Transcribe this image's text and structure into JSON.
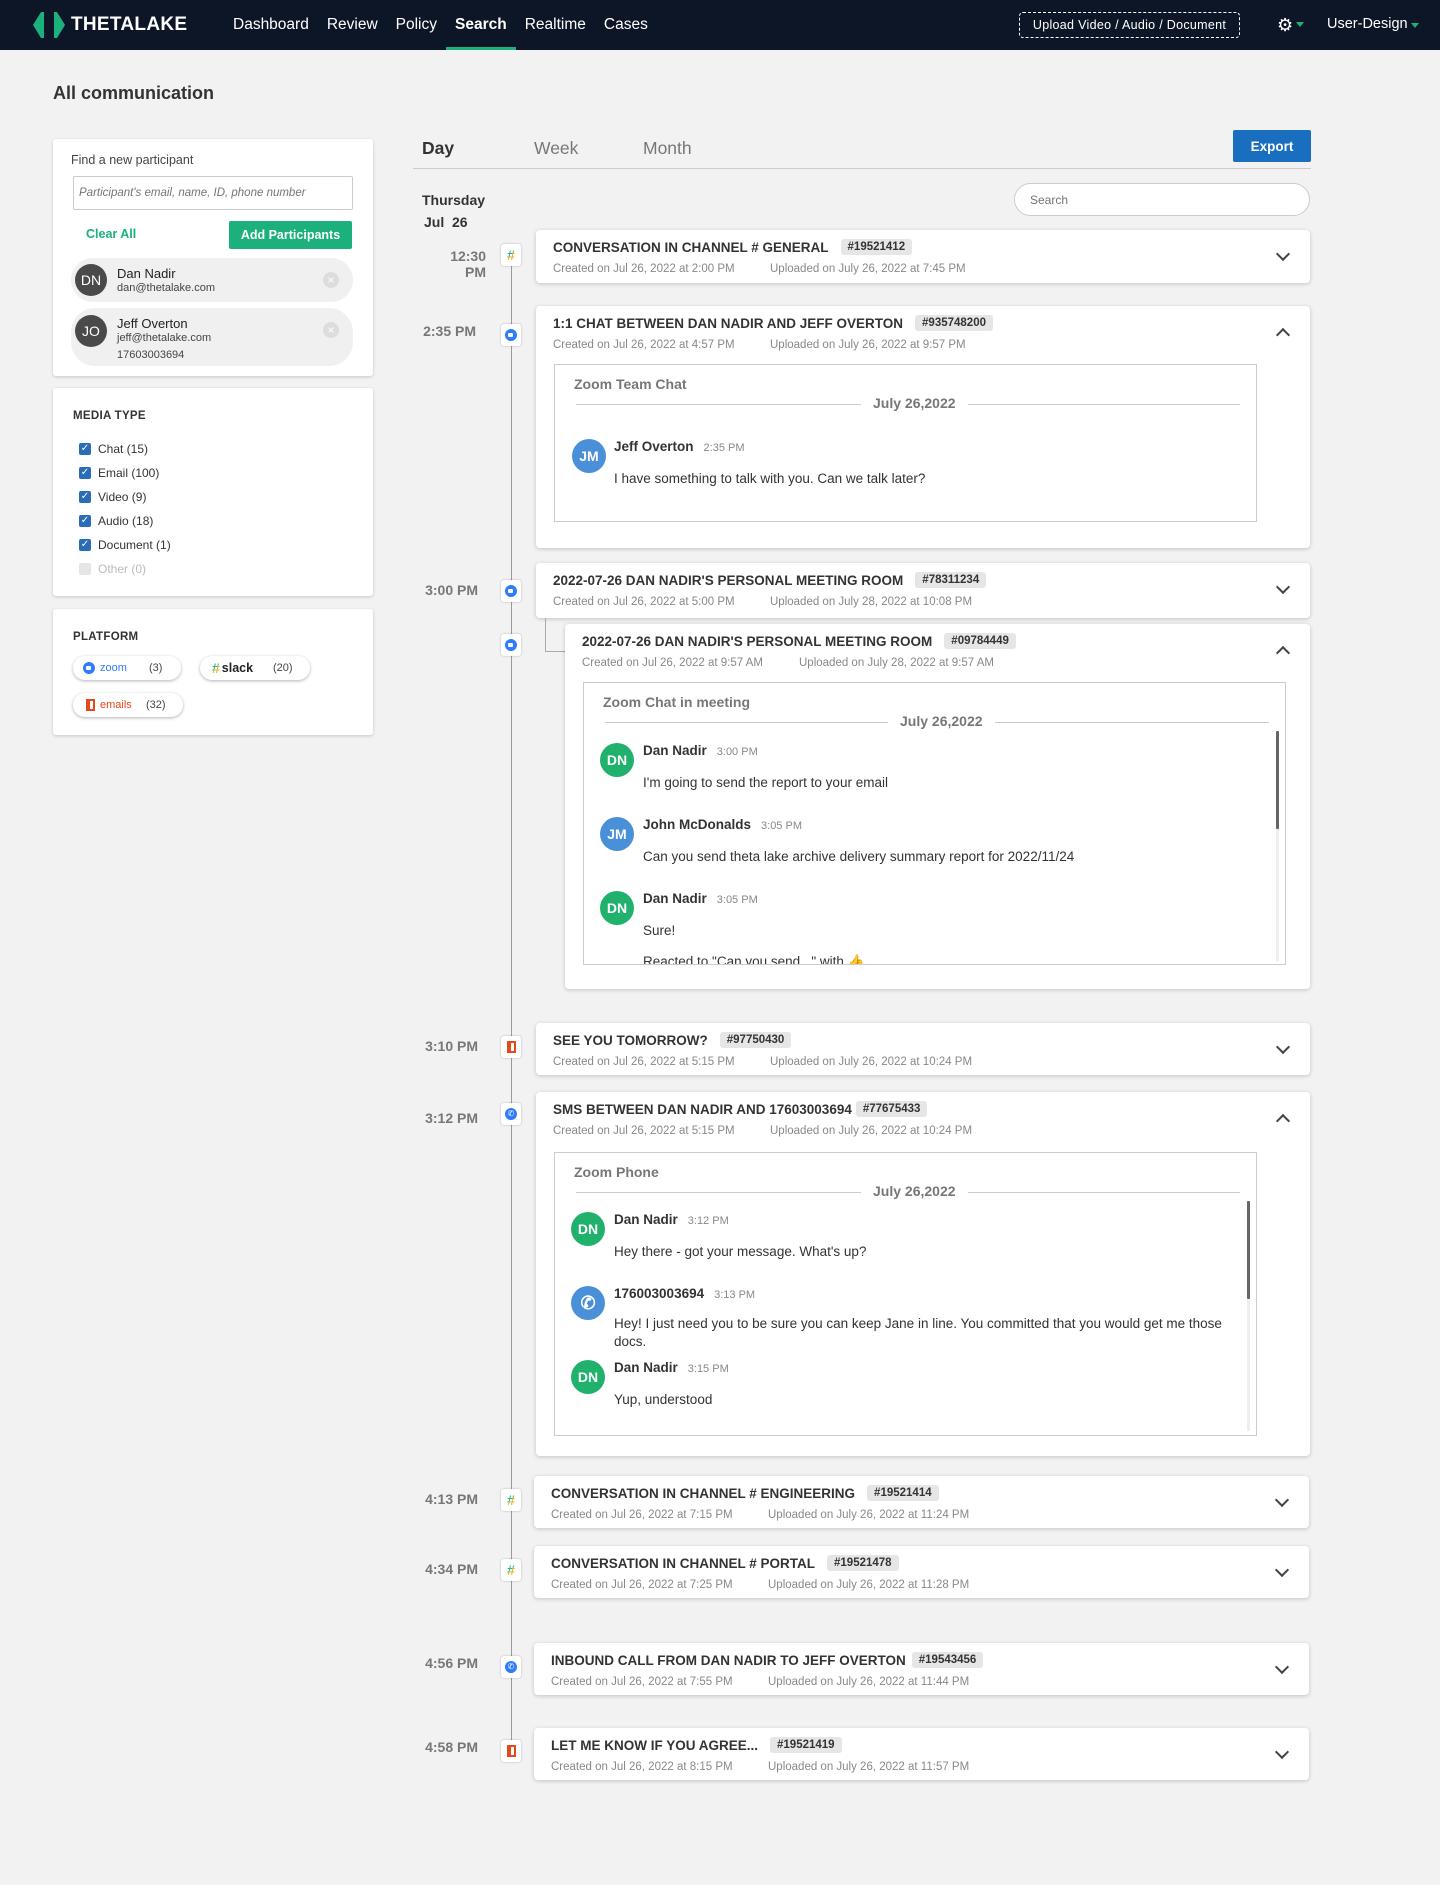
{
  "app": {
    "logo_text": "THETALAKE"
  },
  "nav": {
    "items": [
      {
        "label": "Dashboard",
        "active": false
      },
      {
        "label": "Review",
        "active": false
      },
      {
        "label": "Policy",
        "active": false
      },
      {
        "label": "Search",
        "active": true
      },
      {
        "label": "Realtime",
        "active": false
      },
      {
        "label": "Cases",
        "active": false
      }
    ],
    "upload_label": "Upload Video / Audio / Document",
    "settings_icon": "gear-icon",
    "user_label": "User-Design"
  },
  "colors": {
    "brand_green": "#1bb07c",
    "nav_bg": "#0d1626",
    "export_blue": "#1a6ec0",
    "checkbox_blue": "#2a6cb8",
    "avatar_green": "#20b16d",
    "avatar_blue": "#4a90d9"
  },
  "page": {
    "title": "All communication"
  },
  "participants": {
    "label": "Find a new participant",
    "placeholder": "Participant's email, name, ID, phone number",
    "clear_all": "Clear All",
    "add_button": "Add Participants",
    "list": [
      {
        "initials": "DN",
        "name": "Dan Nadir",
        "email": "dan@thetalake.com",
        "phone": ""
      },
      {
        "initials": "JO",
        "name": "Jeff Overton",
        "email": "jeff@thetalake.com",
        "phone": "17603003694"
      }
    ]
  },
  "media_type": {
    "title": "MEDIA TYPE",
    "items": [
      {
        "label": "Chat (15)",
        "checked": true
      },
      {
        "label": "Email (100)",
        "checked": true
      },
      {
        "label": "Video (9)",
        "checked": true
      },
      {
        "label": "Audio (18)",
        "checked": true
      },
      {
        "label": "Document (1)",
        "checked": true
      },
      {
        "label": "Other (0)",
        "checked": false
      }
    ]
  },
  "platform": {
    "title": "PLATFORM",
    "items": [
      {
        "name": "zoom",
        "count": "(3)",
        "icon": "zoom-icon"
      },
      {
        "name": "slack",
        "count": "(20)",
        "icon": "slack-icon"
      },
      {
        "name": "emails",
        "count": "(32)",
        "icon": "office-icon"
      }
    ]
  },
  "tabs": [
    {
      "label": "Day",
      "active": true
    },
    {
      "label": "Week",
      "active": false
    },
    {
      "label": "Month",
      "active": false
    }
  ],
  "export_label": "Export",
  "date_heading": {
    "weekday": "Thursday",
    "date": "Jul  26"
  },
  "search_placeholder": "Search",
  "events": [
    {
      "time": "12:30 PM",
      "icon": "slack-icon",
      "title": "CONVERSATION IN CHANNEL # GENERAL",
      "id": "#19521412",
      "created": "Created on Jul 26, 2022 at 2:00 PM",
      "uploaded": "Uploaded on July 26, 2022 at 7:45 PM",
      "expanded": false
    },
    {
      "time": "2:35 PM",
      "icon": "zoom-chat-icon",
      "title": "1:1 CHAT BETWEEN DAN NADIR AND JEFF OVERTON",
      "id": "#935748200",
      "created": "Created on Jul 26, 2022 at 4:57 PM",
      "uploaded": "Uploaded on July 26, 2022 at 9:57 PM",
      "expanded": true,
      "chat": {
        "header": "Zoom Team Chat",
        "date": "July 26,2022",
        "messages": [
          {
            "initials": "JM",
            "name": "Jeff Overton",
            "time": "2:35 PM",
            "text": "I have something to talk with you. Can we talk later?"
          }
        ]
      }
    },
    {
      "time": "3:00 PM",
      "icon": "zoom-video-icon",
      "title": "2022-07-26 DAN NADIR'S PERSONAL MEETING ROOM",
      "id": "#78311234",
      "created": "Created on Jul 26, 2022 at 5:00 PM",
      "uploaded": "Uploaded on July 28, 2022 at 10:08 PM",
      "expanded": false
    },
    {
      "time": "",
      "icon": "zoom-video-icon",
      "title": "2022-07-26 DAN NADIR'S PERSONAL MEETING ROOM",
      "id": "#09784449",
      "created": "Created on Jul 26, 2022 at 9:57 AM",
      "uploaded": "Uploaded on July 28, 2022 at 9:57 AM",
      "expanded": true,
      "chat": {
        "header": "Zoom Chat in meeting",
        "date": "July 26,2022",
        "messages": [
          {
            "initials": "DN",
            "name": "Dan Nadir",
            "time": "3:00 PM",
            "text": "I'm going to send the report to your email"
          },
          {
            "initials": "JM",
            "name": "John McDonalds",
            "time": "3:05 PM",
            "text": "Can you send theta lake archive delivery summary report for 2022/11/24"
          },
          {
            "initials": "DN",
            "name": "Dan Nadir",
            "time": "3:05 PM",
            "text": "Sure!",
            "reaction": "Reacted to \"Can you send...\" with 👍"
          }
        ]
      }
    },
    {
      "time": "3:10 PM",
      "icon": "office-icon",
      "title": "SEE YOU TOMORROW?",
      "id": "#97750430",
      "created": "Created on Jul 26, 2022 at 5:15 PM",
      "uploaded": "Uploaded on July 26, 2022 at 10:24 PM",
      "expanded": false
    },
    {
      "time": "3:12 PM",
      "icon": "phone-icon",
      "title": "SMS BETWEEN DAN NADIR AND 17603003694",
      "id": "#77675433",
      "created": "Created on Jul 26, 2022 at 5:15 PM",
      "uploaded": "Uploaded on July 26, 2022 at 10:24 PM",
      "expanded": true,
      "chat": {
        "header": "Zoom Phone",
        "date": "July 26,2022",
        "messages": [
          {
            "initials": "DN",
            "name": "Dan Nadir",
            "time": "3:12 PM",
            "text": "Hey there - got your message. What's up?"
          },
          {
            "initials": "",
            "name": "176003003694",
            "time": "3:13 PM",
            "text": "Hey! I just need you to be sure you can keep Jane in line. You committed that you would get me those docs."
          },
          {
            "initials": "DN",
            "name": "Dan Nadir",
            "time": "3:15 PM",
            "text": "Yup, understood"
          }
        ]
      }
    },
    {
      "time": "4:13 PM",
      "icon": "slack-icon",
      "title": "CONVERSATION IN CHANNEL # ENGINEERING",
      "id": "#19521414",
      "created": "Created on Jul 26, 2022 at 7:15 PM",
      "uploaded": "Uploaded on July 26, 2022 at 11:24 PM",
      "expanded": false
    },
    {
      "time": "4:34 PM",
      "icon": "slack-icon",
      "title": "CONVERSATION IN CHANNEL # PORTAL",
      "id": "#19521478",
      "created": "Created on Jul 26, 2022 at 7:25 PM",
      "uploaded": "Uploaded on July 26, 2022 at 11:28 PM",
      "expanded": false
    },
    {
      "time": "4:56 PM",
      "icon": "phone-icon",
      "title": "INBOUND CALL FROM DAN NADIR TO JEFF OVERTON",
      "id": "#19543456",
      "created": "Created on Jul 26, 2022 at 7:55 PM",
      "uploaded": "Uploaded on July 26, 2022 at 11:44 PM",
      "expanded": false
    },
    {
      "time": "4:58 PM",
      "icon": "office-icon",
      "title": "LET ME KNOW IF YOU AGREE...",
      "id": "#19521419",
      "created": "Created on Jul 26, 2022 at 8:15 PM",
      "uploaded": "Uploaded on July 26, 2022 at 11:57 PM",
      "expanded": false
    }
  ]
}
